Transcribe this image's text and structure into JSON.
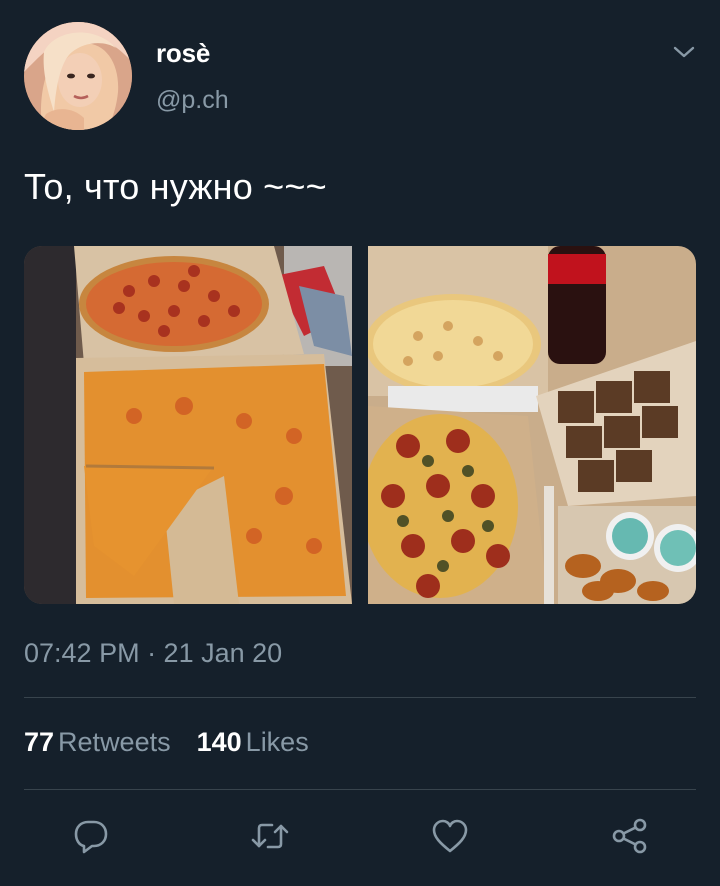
{
  "user": {
    "display_name": "rosè",
    "handle": "@p.ch"
  },
  "tweet": {
    "text": "То, что нужно ~~~",
    "timestamp": "07:42 PM · 21 Jan 20"
  },
  "stats": {
    "retweets_count": "77",
    "retweets_label": "Retweets",
    "likes_count": "140",
    "likes_label": "Likes"
  },
  "icons": {
    "more": "chevron-down-icon",
    "reply": "reply-icon",
    "retweet": "retweet-icon",
    "like": "heart-icon",
    "share": "share-icon"
  },
  "colors": {
    "background": "#15202b",
    "secondary_text": "#8899a6",
    "divider": "#38444d",
    "icon": "#8899a6"
  }
}
